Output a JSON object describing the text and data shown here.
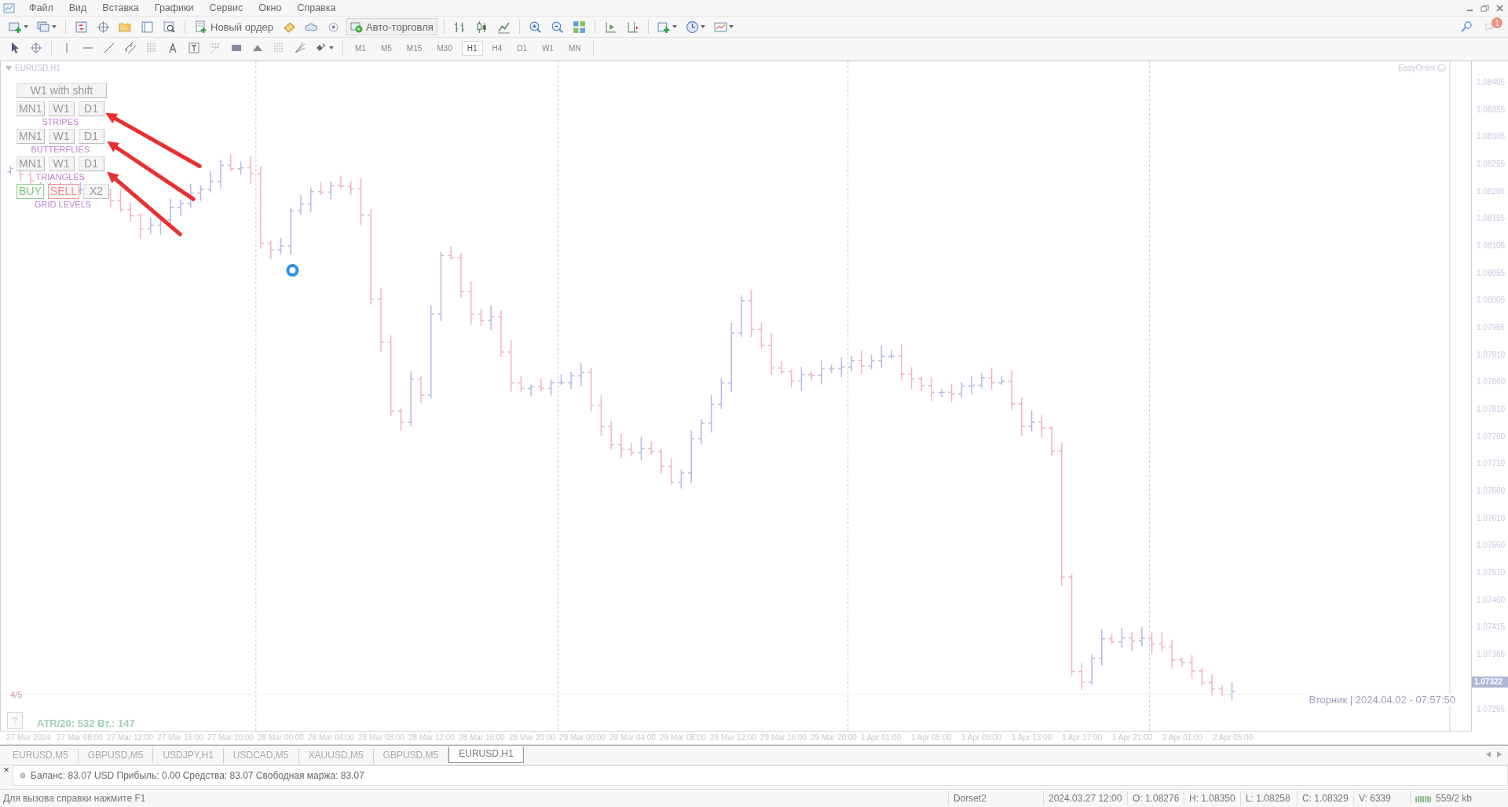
{
  "menu": [
    "Файл",
    "Вид",
    "Вставка",
    "Графики",
    "Сервис",
    "Окно",
    "Справка"
  ],
  "toolbar_buttons": [
    {
      "label": "Новый ордер",
      "kind": "order"
    },
    {
      "label": "Авто-торговля",
      "kind": "auto"
    }
  ],
  "notification_count": "1",
  "timeframes": [
    {
      "label": "M1",
      "selected": false
    },
    {
      "label": "M5",
      "selected": false
    },
    {
      "label": "M15",
      "selected": false
    },
    {
      "label": "M30",
      "selected": false
    },
    {
      "label": "H1",
      "selected": true
    },
    {
      "label": "H4",
      "selected": false
    },
    {
      "label": "D1",
      "selected": false
    },
    {
      "label": "W1",
      "selected": false
    },
    {
      "label": "MN",
      "selected": false
    }
  ],
  "chart": {
    "title": "EURUSD,H1",
    "expert": "EasyOrder",
    "top_button": "W1 with shift",
    "groups": [
      {
        "label": "STRIPES",
        "buttons": [
          {
            "label": "MN1",
            "kind": "plain"
          },
          {
            "label": "W1",
            "kind": "plain"
          },
          {
            "label": "D1",
            "kind": "plain"
          }
        ]
      },
      {
        "label": "BUTTERFLIES",
        "buttons": [
          {
            "label": "MN1",
            "kind": "plain"
          },
          {
            "label": "W1",
            "kind": "plain"
          },
          {
            "label": "D1",
            "kind": "plain"
          }
        ]
      },
      {
        "label": "TRIANGLES",
        "buttons": [
          {
            "label": "MN1",
            "kind": "plain"
          },
          {
            "label": "W1",
            "kind": "plain"
          },
          {
            "label": "D1",
            "kind": "plain"
          }
        ]
      },
      {
        "label": "GRID LEVELS",
        "buttons": [
          {
            "label": "BUY",
            "kind": "buy"
          },
          {
            "label": "SELL",
            "kind": "sell"
          },
          {
            "label": "X2",
            "kind": "plain"
          }
        ]
      }
    ],
    "page": "4/5",
    "help": "?",
    "atr": "ATR/20: 532  Вт.: 147",
    "server_time": "Вторник | 2024.04.02 - 07:57:50",
    "price_axis": [
      {
        "label": "1.08405",
        "current": false
      },
      {
        "label": "1.08355",
        "current": false
      },
      {
        "label": "1.08305",
        "current": false
      },
      {
        "label": "1.08255",
        "current": false
      },
      {
        "label": "1.08205",
        "current": false
      },
      {
        "label": "1.08155",
        "current": false
      },
      {
        "label": "1.08105",
        "current": false
      },
      {
        "label": "1.08055",
        "current": false
      },
      {
        "label": "1.08005",
        "current": false
      },
      {
        "label": "1.07955",
        "current": false
      },
      {
        "label": "1.07910",
        "current": false
      },
      {
        "label": "1.07860",
        "current": false
      },
      {
        "label": "1.07810",
        "current": false
      },
      {
        "label": "1.07760",
        "current": false
      },
      {
        "label": "1.07710",
        "current": false
      },
      {
        "label": "1.07660",
        "current": false
      },
      {
        "label": "1.07610",
        "current": false
      },
      {
        "label": "1.07560",
        "current": false
      },
      {
        "label": "1.07510",
        "current": false
      },
      {
        "label": "1.07460",
        "current": false
      },
      {
        "label": "1.07415",
        "current": false
      },
      {
        "label": "1.07365",
        "current": false
      },
      {
        "label": "1.07322",
        "current": true
      },
      {
        "label": "1.07265",
        "current": false
      }
    ],
    "time_axis": [
      "27 Mar 2024",
      "27 Mar 08:00",
      "27 Mar 12:00",
      "27 Mar 16:00",
      "27 Mar 20:00",
      "28 Mar 00:00",
      "28 Mar 04:00",
      "28 Mar 08:00",
      "28 Mar 12:00",
      "28 Mar 16:00",
      "28 Mar 20:00",
      "29 Mar 00:00",
      "29 Mar 04:00",
      "29 Mar 08:00",
      "29 Mar 12:00",
      "29 Mar 16:00",
      "29 Mar 20:00",
      "1 Apr 01:00",
      "1 Apr 05:00",
      "1 Apr 09:00",
      "1 Apr 13:00",
      "1 Apr 17:00",
      "1 Apr 21:00",
      "2 Apr 01:00",
      "2 Apr 05:00"
    ]
  },
  "chart_tabs": [
    {
      "label": "EURUSD,M5",
      "selected": false
    },
    {
      "label": "GBPUSD,M5",
      "selected": false
    },
    {
      "label": "USDJPY,H1",
      "selected": false
    },
    {
      "label": "USDCAD,M5",
      "selected": false
    },
    {
      "label": "XAUUSD,M5",
      "selected": false
    },
    {
      "label": "GBPUSD,M5",
      "selected": false
    },
    {
      "label": "EURUSD,H1",
      "selected": true
    }
  ],
  "terminal": {
    "close": "×",
    "account": "Баланс: 83.07 USD  Прибыль: 0.00  Средства: 83.07  Свободная маржа: 83.07"
  },
  "status_bar": {
    "help": "Для вызова справки нажмите F1",
    "profile": "Dorset2",
    "time": "2024.03.27 12:00",
    "open": "O: 1.08276",
    "high": "H: 1.08350",
    "low": "L: 1.08258",
    "close": "C: 1.08329",
    "volume": "V: 6339",
    "traffic": "559/2 kb"
  }
}
